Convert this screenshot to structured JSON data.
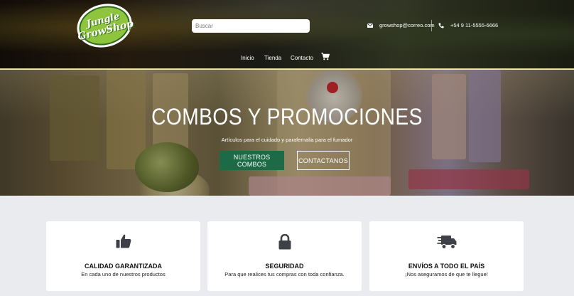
{
  "header": {
    "logo": {
      "line1": "Jungle",
      "line2": "GrowShop"
    },
    "search": {
      "placeholder": "Buscar",
      "value": ""
    },
    "email": "growshop@correo.com",
    "phone": "+54 9 11-5555-6666",
    "nav": [
      {
        "label": "Inicio"
      },
      {
        "label": "Tienda"
      },
      {
        "label": "Contacto"
      }
    ],
    "icons": {
      "email": "envelope-icon",
      "phone": "phone-icon",
      "cart": "cart-icon"
    }
  },
  "hero": {
    "title": "COMBOS Y PROMOCIONES",
    "subtitle": "Artículos para el cuidado y parafernalia para el fumador",
    "primary_button": "NUESTROS COMBOS",
    "secondary_button": "CONTACTANOS",
    "colors": {
      "primary_button": "#1c6b46"
    }
  },
  "features": [
    {
      "icon": "thumbs-up-icon",
      "title": "CALIDAD GARANTIZADA",
      "desc": "En cada uno de nuestros productos"
    },
    {
      "icon": "lock-icon",
      "title": "SEGURIDAD",
      "desc": "Para que realices tus compras con toda confianza."
    },
    {
      "icon": "truck-icon",
      "title": "ENVÍOS A TODO EL PAÍS",
      "desc": "¡Nos aseguramos de que te llegue!"
    }
  ],
  "colors": {
    "icon": "#3d4147",
    "background": "#e9ebee"
  }
}
